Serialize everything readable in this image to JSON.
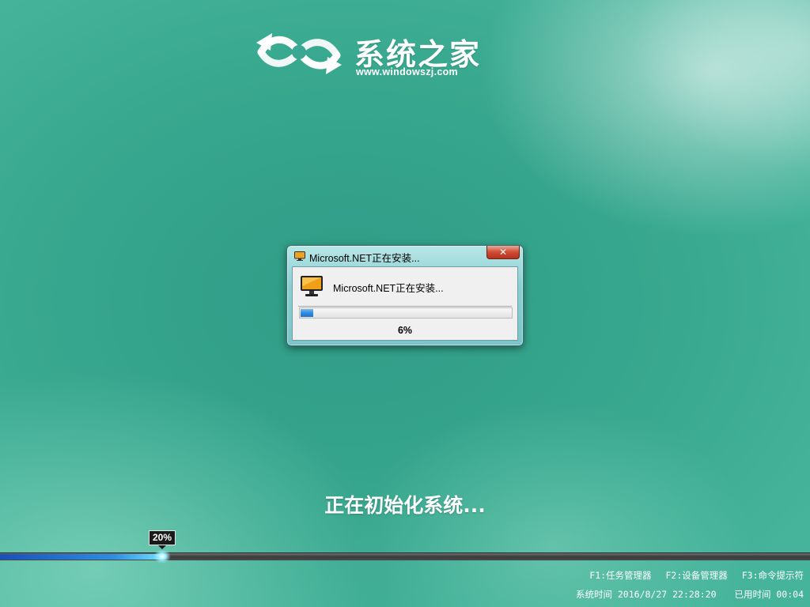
{
  "logo": {
    "icon": "infinity-arrows-logo",
    "name": "系统之家",
    "url": "www.windowszj.com"
  },
  "dialog": {
    "title": "Microsoft.NET正在安装...",
    "title_icon": "monitor-icon",
    "close_label": "✕",
    "message": "Microsoft.NET正在安装...",
    "message_icon": "monitor-icon",
    "progress_fraction": 0.06,
    "progress_text": "6%"
  },
  "status": {
    "text": "正在初始化系统..."
  },
  "main_progress": {
    "fraction": 0.2,
    "label": "20%"
  },
  "footer": {
    "hotkeys": [
      "F1:任务管理器",
      "F2:设备管理器",
      "F3:命令提示符"
    ],
    "system_time": "系统时间 2016/8/27 22:28:20",
    "elapsed_time": "已用时间 00:04"
  },
  "colors": {
    "background": "#38a88f",
    "progress_blue": "#2f8be0",
    "close_red": "#cf4a33"
  }
}
